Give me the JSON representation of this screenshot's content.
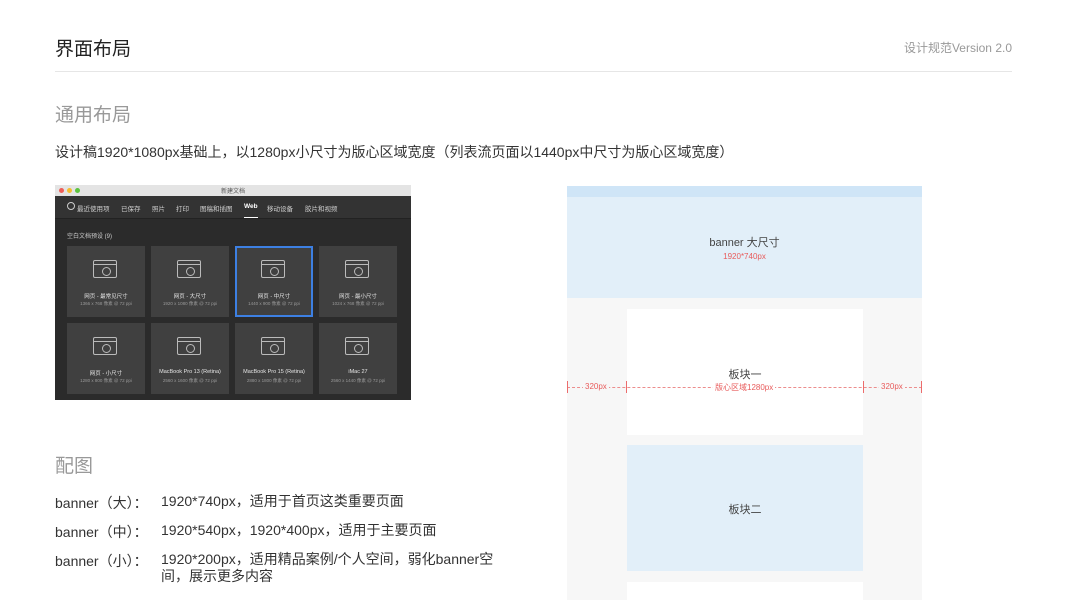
{
  "header": {
    "title": "界面布局",
    "version": "设计规范Version 2.0"
  },
  "layout_section": {
    "title": "通用布局",
    "description": "设计稿1920*1080px基础上，以1280px小尺寸为版心区域宽度（列表流页面以1440px中尺寸为版心区域宽度）"
  },
  "app": {
    "window_title": "新建文档",
    "traffic_light_colors": [
      "#ee5e57",
      "#f5bd2f",
      "#5cc33f"
    ],
    "tabs": [
      "最近使用项",
      "已保存",
      "照片",
      "打印",
      "图稿和插图",
      "Web",
      "移动设备",
      "胶片和视频"
    ],
    "active_tab": "Web",
    "preset_header": "空白文档预设 (9)",
    "cards": [
      {
        "name": "网页 - 最常见尺寸",
        "size": "1366 x 768 像素 @ 72 ppi",
        "selected": false
      },
      {
        "name": "网页 - 大尺寸",
        "size": "1920 x 1080 像素 @ 72 ppi",
        "selected": false
      },
      {
        "name": "网页 - 中尺寸",
        "size": "1440 x 900 像素 @ 72 ppi",
        "selected": true
      },
      {
        "name": "网页 - 最小尺寸",
        "size": "1024 x 768 像素 @ 72 ppi",
        "selected": false
      },
      {
        "name": "网页 - 小尺寸",
        "size": "1280 x 800 像素 @ 72 ppi",
        "selected": false
      },
      {
        "name": "MacBook Pro 13 (Retina)",
        "size": "2560 x 1600 像素 @ 72 ppi",
        "selected": false
      },
      {
        "name": "MacBook Pro 15 (Retina)",
        "size": "2880 x 1800 像素 @ 72 ppi",
        "selected": false
      },
      {
        "name": "iMac 27",
        "size": "2560 x 1440 像素 @ 72 ppi",
        "selected": false
      }
    ]
  },
  "diagram": {
    "banner_label": "banner 大尺寸",
    "banner_size": "1920*740px",
    "block1": "板块一",
    "block2": "板块二",
    "left_margin": "320px",
    "center_width": "版心区域1280px",
    "right_margin": "320px"
  },
  "figure_section": {
    "title": "配图",
    "rows": [
      {
        "key": "banner（大）：",
        "value": "1920*740px，适用于首页这类重要页面"
      },
      {
        "key": "banner（中）：",
        "value": "1920*540px，1920*400px，适用于主要页面"
      },
      {
        "key": "banner（小）：",
        "value": "1920*200px，适用精品案例/个人空间，弱化banner空间，展示更多内容"
      }
    ]
  }
}
